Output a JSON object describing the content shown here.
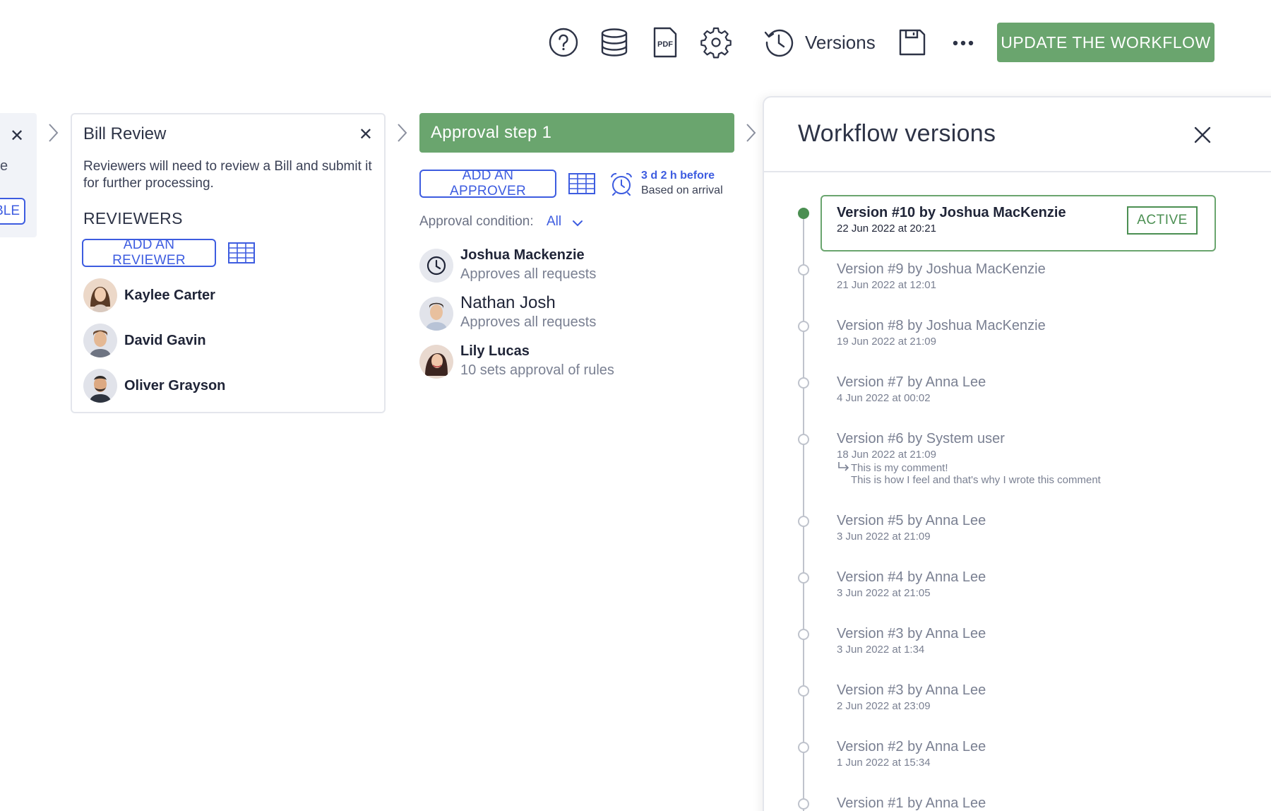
{
  "toolbar": {
    "help_icon": "question-circle-icon",
    "database_icon": "database-icon",
    "pdf_icon": "pdf-icon",
    "pdf_text": "PDF",
    "settings_icon": "gear-icon",
    "versions_label": "Versions",
    "save_icon": "floppy-disk-icon",
    "more_icon": "ellipsis-icon",
    "update_label": "UPDATE THE WORKFLOW"
  },
  "partial": {
    "text": "e",
    "button": "BLE"
  },
  "bill_review": {
    "title": "Bill Review",
    "description": "Reviewers will need to review a Bill and submit it for further processing.",
    "section": "REVIEWERS",
    "add_label": "ADD AN REVIEWER",
    "reviewers": [
      {
        "name": "Kaylee Carter"
      },
      {
        "name": "David Gavin"
      },
      {
        "name": "Oliver Grayson"
      }
    ]
  },
  "approval": {
    "title": "Approval step 1",
    "add_label": "ADD AN APPROVER",
    "reminder_time": "3 d 2 h before",
    "reminder_basis": "Based on arrival",
    "condition_label": "Approval condition:",
    "condition_value": "All",
    "approvers": [
      {
        "name": "Joshua Mackenzie",
        "role": "Approves all requests"
      },
      {
        "name": "Nathan Josh",
        "role": "Approves all requests"
      },
      {
        "name": "Lily Lucas",
        "role": "10 sets approval of rules"
      }
    ]
  },
  "versions_panel": {
    "title": "Workflow versions",
    "active_badge": "ACTIVE",
    "items": [
      {
        "title": "Version #10 by Joshua MacKenzie",
        "date": "22 Jun 2022 at 20:21"
      },
      {
        "title": "Version #9 by Joshua MacKenzie",
        "date": "21 Jun 2022 at 12:01"
      },
      {
        "title": "Version #8 by Joshua MacKenzie",
        "date": "19 Jun 2022 at 21:09"
      },
      {
        "title": "Version #7 by Anna Lee",
        "date": "4 Jun 2022 at 00:02"
      },
      {
        "title": "Version #6 by System user",
        "date": "18 Jun 2022 at 21:09",
        "comment_1": "This is my comment!",
        "comment_2": "This is how I feel and that's why I wrote this comment"
      },
      {
        "title": "Version #5 by Anna Lee",
        "date": "3 Jun 2022 at 21:09"
      },
      {
        "title": "Version #4 by Anna Lee",
        "date": "3 Jun 2022 at 21:05"
      },
      {
        "title": "Version #3 by Anna Lee",
        "date": "3 Jun 2022 at 1:34"
      },
      {
        "title": "Version #3 by Anna Lee",
        "date": "2 Jun 2022 at 23:09"
      },
      {
        "title": "Version #2 by Anna Lee",
        "date": "1 Jun 2022 at 15:34"
      },
      {
        "title": "Version #1 by Anna Lee",
        "date": ""
      }
    ]
  },
  "colors": {
    "primary_green": "#6aa56e",
    "active_green": "#4b8f52",
    "link_blue": "#3d5ce0",
    "text_dark": "#1f2437",
    "text_muted": "#7a8092"
  }
}
